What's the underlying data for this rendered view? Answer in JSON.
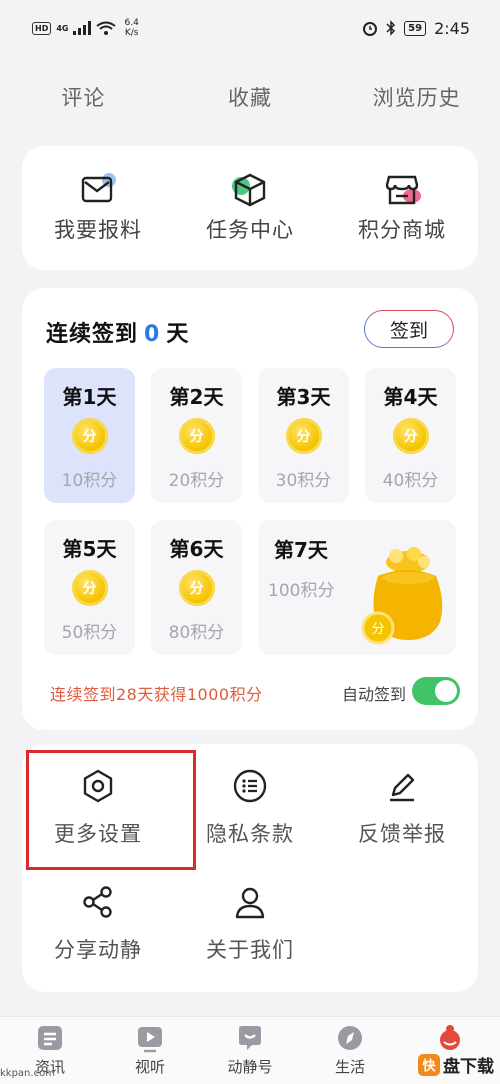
{
  "status_bar": {
    "network": "HD",
    "signal": "4G",
    "speed_value": "6.4",
    "speed_unit": "K/s",
    "battery": "59",
    "time": "2:45"
  },
  "top_tabs": [
    "评论",
    "收藏",
    "浏览历史"
  ],
  "quick_actions": [
    {
      "label": "我要报料",
      "icon": "mail-report-icon"
    },
    {
      "label": "任务中心",
      "icon": "task-box-icon"
    },
    {
      "label": "积分商城",
      "icon": "store-icon"
    }
  ],
  "checkin": {
    "title_prefix": "连续签到",
    "days": "0",
    "title_suffix": "天",
    "sign_button": "签到",
    "coin_label": "分",
    "tiles": [
      {
        "day": "第1天",
        "points": "10积分"
      },
      {
        "day": "第2天",
        "points": "20积分"
      },
      {
        "day": "第3天",
        "points": "30积分"
      },
      {
        "day": "第4天",
        "points": "40积分"
      },
      {
        "day": "第5天",
        "points": "50积分"
      },
      {
        "day": "第6天",
        "points": "80积分"
      },
      {
        "day": "第7天",
        "points": "100积分"
      }
    ],
    "streak_reward": "连续签到28天获得1000积分",
    "auto_sign_label": "自动签到",
    "auto_sign_on": true
  },
  "settings": [
    {
      "label": "更多设置",
      "icon": "hexagon-settings-icon"
    },
    {
      "label": "隐私条款",
      "icon": "list-circle-icon"
    },
    {
      "label": "反馈举报",
      "icon": "pencil-icon"
    },
    {
      "label": "分享动静",
      "icon": "share-icon"
    },
    {
      "label": "关于我们",
      "icon": "person-icon"
    }
  ],
  "bottom_nav": [
    {
      "label": "资讯",
      "icon": "news-icon"
    },
    {
      "label": "视听",
      "icon": "video-icon"
    },
    {
      "label": "动静号",
      "icon": "chat-icon"
    },
    {
      "label": "生活",
      "icon": "compass-icon"
    },
    {
      "label": "",
      "icon": "profile-icon"
    }
  ],
  "watermark": {
    "left": "kkpan.com",
    "right": "盘下载"
  },
  "colors": {
    "accent_blue": "#2a79e6",
    "reward_text": "#e15a3c",
    "toggle_on": "#3fc46a",
    "highlight": "#d92b2b",
    "coin": "#f5c400"
  }
}
